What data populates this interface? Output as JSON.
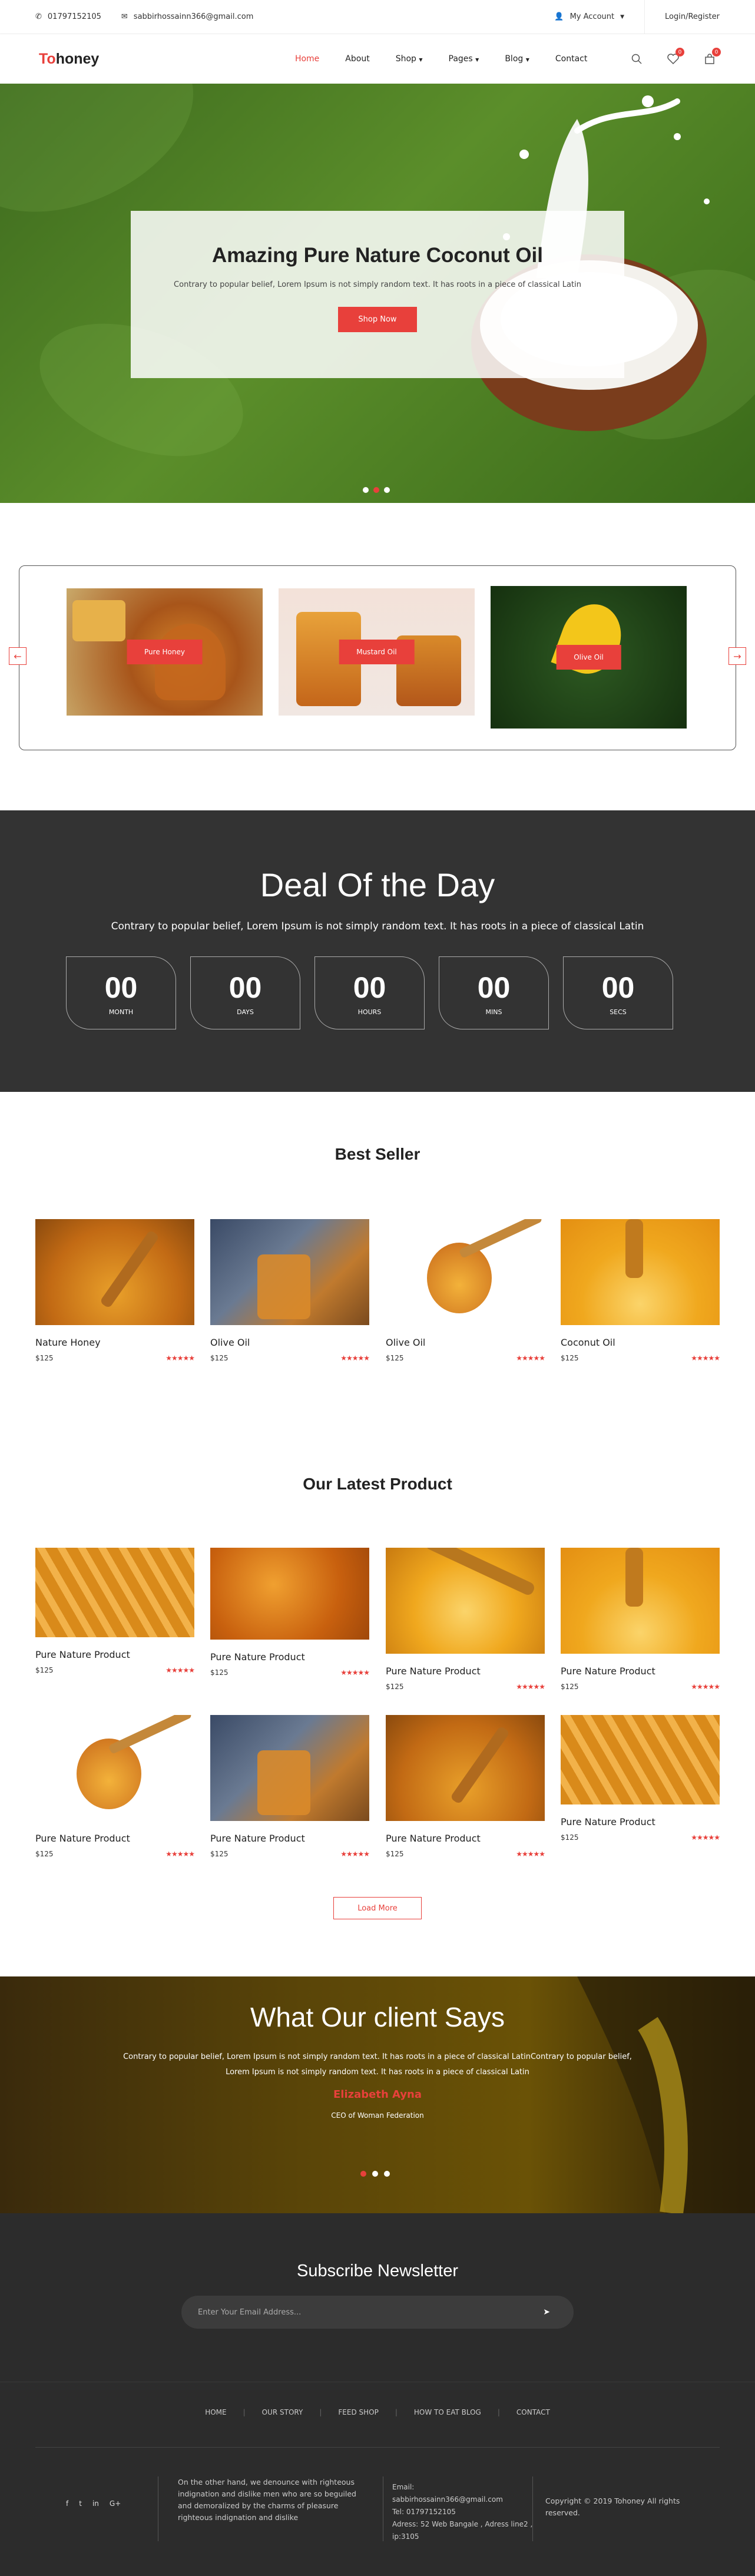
{
  "topbar": {
    "phone": "01797152105",
    "email": "sabbirhossainn366@gmail.com",
    "account": "My Account",
    "login": "Login/Register"
  },
  "nav": {
    "logo_first": "To",
    "logo_rest": "honey",
    "items": [
      "Home",
      "About",
      "Shop",
      "Pages",
      "Blog",
      "Contact"
    ],
    "wishlist_count": "0",
    "cart_count": "0"
  },
  "hero": {
    "title": "Amazing Pure Nature Coconut Oil",
    "text": "Contrary to popular belief, Lorem Ipsum is not simply random text. It has roots in a piece of classical Latin",
    "button": "Shop Now"
  },
  "categories": [
    "Pure Honey",
    "Mustard Oil",
    "Olive Oil"
  ],
  "deal": {
    "title": "Deal Of the Day",
    "text": "Contrary to popular belief, Lorem Ipsum is not simply random text. It has roots in a piece of classical Latin",
    "timer": [
      {
        "value": "00",
        "unit": "MONTH"
      },
      {
        "value": "00",
        "unit": "DAYS"
      },
      {
        "value": "00",
        "unit": "HOURS"
      },
      {
        "value": "00",
        "unit": "MINS"
      },
      {
        "value": "00",
        "unit": "SECS"
      }
    ]
  },
  "best_seller": {
    "title": "Best Seller",
    "products": [
      {
        "name": "Nature Honey",
        "price": "$125"
      },
      {
        "name": "Olive Oil",
        "price": "$125"
      },
      {
        "name": "Olive Oil",
        "price": "$125"
      },
      {
        "name": "Coconut Oil",
        "price": "$125"
      }
    ]
  },
  "latest": {
    "title": "Our Latest Product",
    "products": [
      {
        "name": "Pure Nature Product",
        "price": "$125"
      },
      {
        "name": "Pure Nature Product",
        "price": "$125"
      },
      {
        "name": "Pure Nature Product",
        "price": "$125"
      },
      {
        "name": "Pure Nature Product",
        "price": "$125"
      },
      {
        "name": "Pure Nature Product",
        "price": "$125"
      },
      {
        "name": "Pure Nature Product",
        "price": "$125"
      },
      {
        "name": "Pure Nature Product",
        "price": "$125"
      },
      {
        "name": "Pure Nature Product",
        "price": "$125"
      }
    ],
    "load_more": "Load More"
  },
  "testimonial": {
    "title": "What Our client Says",
    "text": "Contrary to popular belief, Lorem Ipsum is not simply random text. It has roots in a piece of classical LatinContrary to popular belief, Lorem Ipsum is not simply random text. It has roots in a piece of classical Latin",
    "name": "Elizabeth Ayna",
    "role": "CEO of Woman Federation"
  },
  "newsletter": {
    "title": "Subscribe Newsletter",
    "placeholder": "Enter Your Email Address..."
  },
  "footer": {
    "links": [
      "HOME",
      "OUR STORY",
      "FEED SHOP",
      "HOW TO EAT BLOG",
      "CONTACT"
    ],
    "about": "On the other hand, we denounce with righteous indignation and dislike men who are so beguiled and demoralized by the charms of pleasure righteous indignation and dislike",
    "email_label": "Email:",
    "email": "sabbirhossainn366@gmail.com",
    "tel": "Tel: 01797152105",
    "address": "Adress: 52 Web Bangale , Adress line2 , ip:3105",
    "copyright": "Copyright © 2019 Tohoney All rights reserved."
  }
}
